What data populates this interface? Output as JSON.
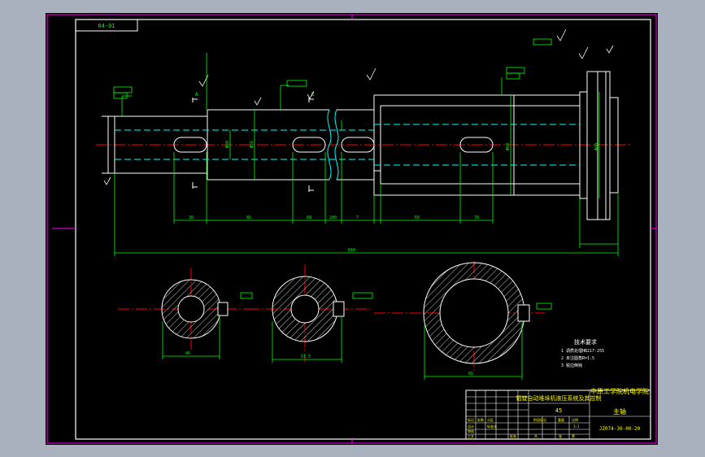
{
  "colors": {
    "frame": "#ff00ff",
    "outline": "#ffffff",
    "dimension": "#00ff00",
    "center": "#ff0000",
    "hidden": "#00ffff",
    "note": "#ffff00",
    "title_text": "#ffff00"
  },
  "corner_tag": "04-01",
  "technical_requirements": {
    "heading": "技术要求",
    "items": [
      "1 调质处理HB217-255",
      "2 未注圆角R=1.5",
      "3 锐边倒钝"
    ]
  },
  "title_block": {
    "school": "中原工学院机电学院",
    "part_name": "主轴",
    "drawing_number": "JZ074-30-00-20",
    "project": "铝锭自动堆垛机液压系统及其控制",
    "material": "45"
  },
  "dimensions": {
    "overall_length": "660",
    "segments": [
      "30",
      "85",
      "60",
      "200",
      "7",
      "60",
      "70"
    ],
    "diameters": [
      "Φ50",
      "Φ55",
      "Φ60",
      "Φ80"
    ],
    "sections": [
      "46",
      "51.5",
      "65"
    ]
  }
}
